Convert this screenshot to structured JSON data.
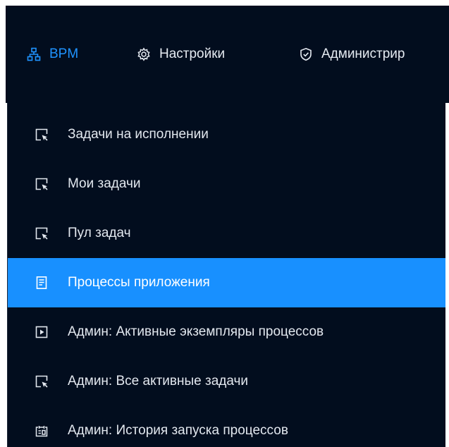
{
  "topnav": {
    "items": [
      {
        "label": "BPM",
        "icon": "org-chart-icon",
        "color": "#1f93ff"
      },
      {
        "label": "Настройки",
        "icon": "gear-icon"
      },
      {
        "label": "Администрир",
        "icon": "shield-check-icon"
      }
    ]
  },
  "menu": {
    "active_color": "#1890ff",
    "background": "#020d1e",
    "items": [
      {
        "label": "Задачи на исполнении",
        "icon": "select-cursor-icon"
      },
      {
        "label": "Мои задачи",
        "icon": "select-cursor-icon"
      },
      {
        "label": "Пул задач",
        "icon": "select-cursor-icon"
      },
      {
        "label": "Процессы приложения",
        "icon": "document-list-icon",
        "active": true
      },
      {
        "label": "Админ: Активные экземпляры процессов",
        "icon": "play-square-icon"
      },
      {
        "label": "Админ: Все активные задачи",
        "icon": "select-cursor-icon"
      },
      {
        "label": "Админ: История запуска процессов",
        "icon": "history-calendar-icon"
      }
    ]
  }
}
